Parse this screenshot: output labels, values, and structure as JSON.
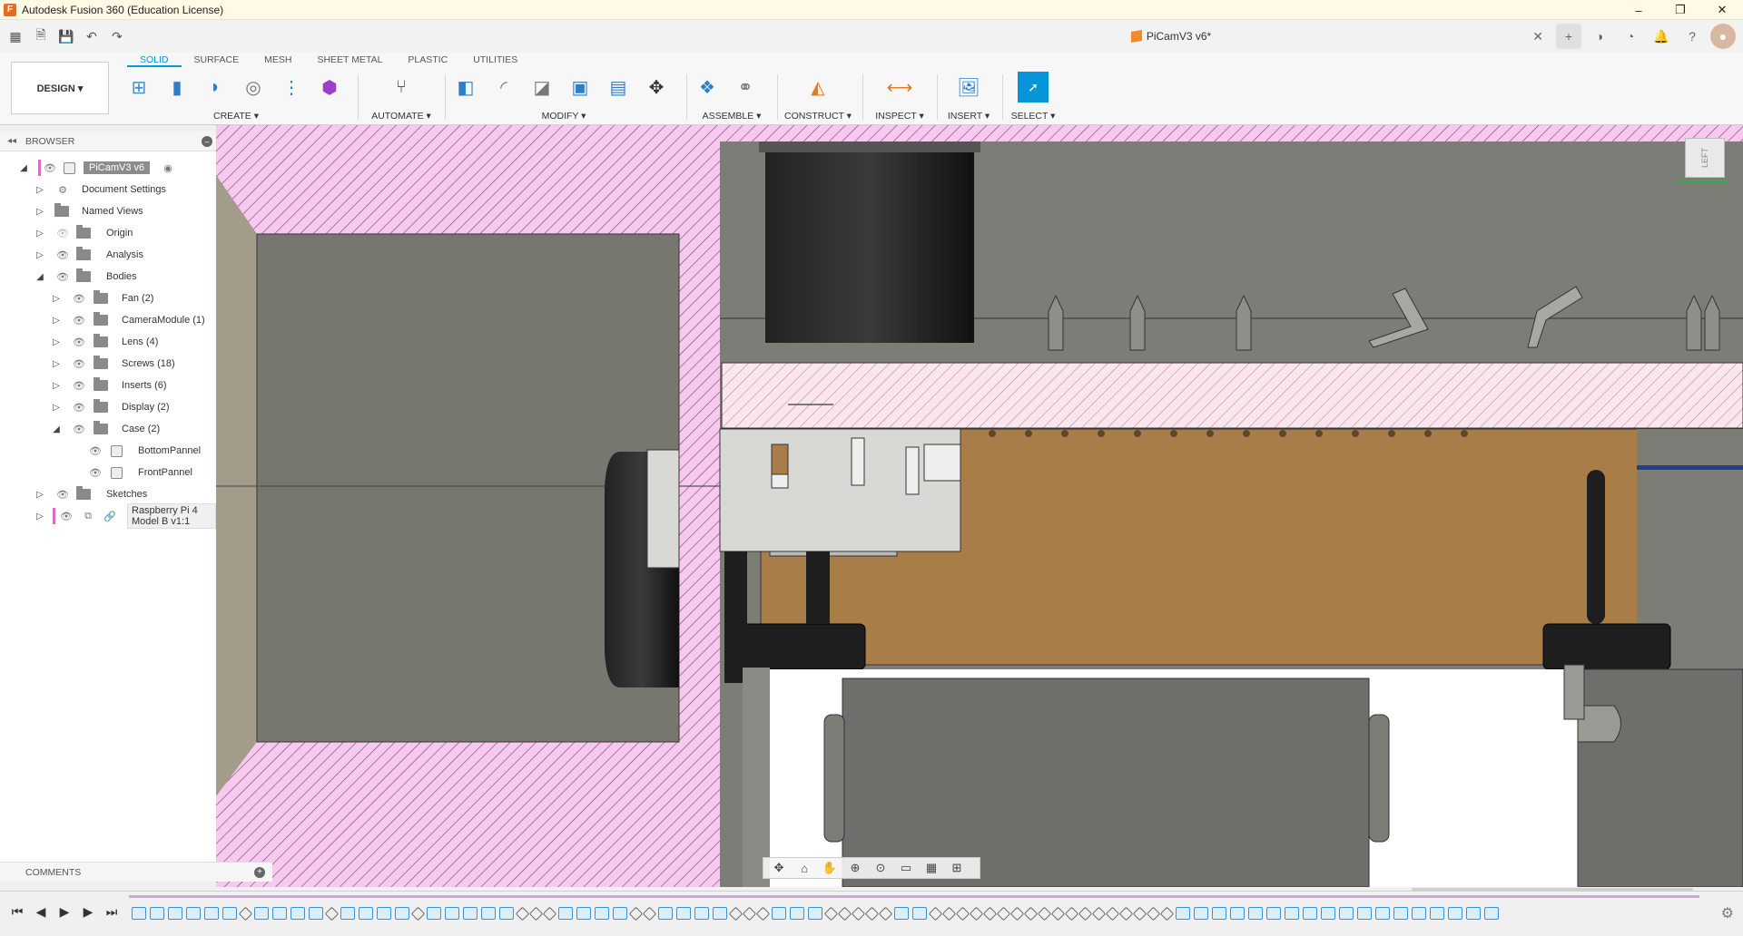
{
  "window": {
    "title": "Autodesk Fusion 360 (Education License)",
    "controls": [
      "–",
      "❐",
      "✕"
    ]
  },
  "document": {
    "tab_title": "PiCamV3 v6*"
  },
  "ribbon": {
    "workspace": "DESIGN ▾",
    "tabs": [
      "SOLID",
      "SURFACE",
      "MESH",
      "SHEET METAL",
      "PLASTIC",
      "UTILITIES"
    ],
    "groups": {
      "create": "CREATE ▾",
      "automate": "AUTOMATE ▾",
      "modify": "MODIFY ▾",
      "assemble": "ASSEMBLE ▾",
      "construct": "CONSTRUCT ▾",
      "inspect": "INSPECT ▾",
      "insert": "INSERT ▾",
      "select": "SELECT ▾"
    }
  },
  "browser": {
    "header": "BROWSER",
    "root": "PiCamV3 v6",
    "items": [
      {
        "label": "Document Settings"
      },
      {
        "label": "Named Views"
      },
      {
        "label": "Origin"
      },
      {
        "label": "Analysis"
      },
      {
        "label": "Bodies"
      },
      {
        "label": "Fan (2)"
      },
      {
        "label": "CameraModule (1)"
      },
      {
        "label": "Lens (4)"
      },
      {
        "label": "Screws (18)"
      },
      {
        "label": "Inserts (6)"
      },
      {
        "label": "Display (2)"
      },
      {
        "label": "Case (2)"
      },
      {
        "label": "BottomPannel"
      },
      {
        "label": "FrontPannel"
      },
      {
        "label": "Sketches"
      },
      {
        "label": "Raspberry Pi 4 Model B v1:1"
      }
    ]
  },
  "comments": {
    "label": "COMMENTS"
  },
  "viewcube": {
    "face": "LEFT"
  },
  "colors": {
    "accent": "#0696d7",
    "section_hatch": "#d36cc3",
    "board": "#a87d48"
  }
}
